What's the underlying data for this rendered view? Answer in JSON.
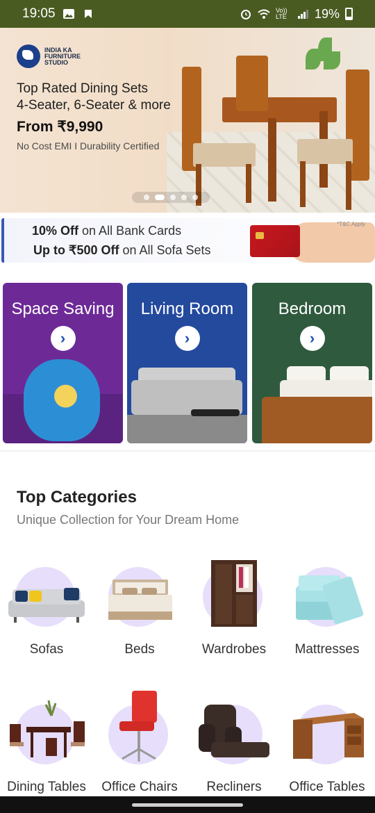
{
  "status_bar": {
    "time": "19:05",
    "network": "Vo)) LTE",
    "battery": "19%",
    "icons": [
      "image-icon",
      "notification-icon",
      "alarm-icon",
      "wifi-icon",
      "volte-icon",
      "signal-icon",
      "battery-icon"
    ]
  },
  "hero": {
    "brand": "INDIA KA FURNITURE STUDIO",
    "title_line1": "Top Rated Dining Sets",
    "title_line2": "4-Seater, 6-Seater & more",
    "price": "From ₹9,990",
    "note": "No Cost EMI I Durability Certified",
    "carousel_total": 5,
    "carousel_active": 2
  },
  "offer": {
    "line1_bold": "10% Off",
    "line1_rest": " on All Bank Cards",
    "line2_bold": "Up to ₹500 Off",
    "line2_rest": " on All Sofa Sets",
    "tc": "*T&C Apply"
  },
  "category_cards": [
    {
      "label": "Space Saving",
      "arrow": "›"
    },
    {
      "label": "Living Room",
      "arrow": "›"
    },
    {
      "label": "Bedroom",
      "arrow": "›"
    }
  ],
  "top_categories": {
    "title": "Top Categories",
    "subtitle": "Unique Collection for Your Dream Home",
    "items": [
      {
        "label": "Sofas",
        "icon": "sofa-icon"
      },
      {
        "label": "Beds",
        "icon": "bed-icon"
      },
      {
        "label": "Wardrobes",
        "icon": "wardrobe-icon"
      },
      {
        "label": "Mattresses",
        "icon": "mattress-icon"
      },
      {
        "label": "Dining Tables",
        "icon": "dining-table-icon"
      },
      {
        "label": "Office Chairs",
        "icon": "office-chair-icon"
      },
      {
        "label": "Recliners",
        "icon": "recliner-icon"
      },
      {
        "label": "Office Tables",
        "icon": "office-table-icon"
      }
    ]
  },
  "colors": {
    "status_bar": "#4a5b22",
    "accent_blue": "#1b52b3",
    "blob": "#e6defa"
  }
}
